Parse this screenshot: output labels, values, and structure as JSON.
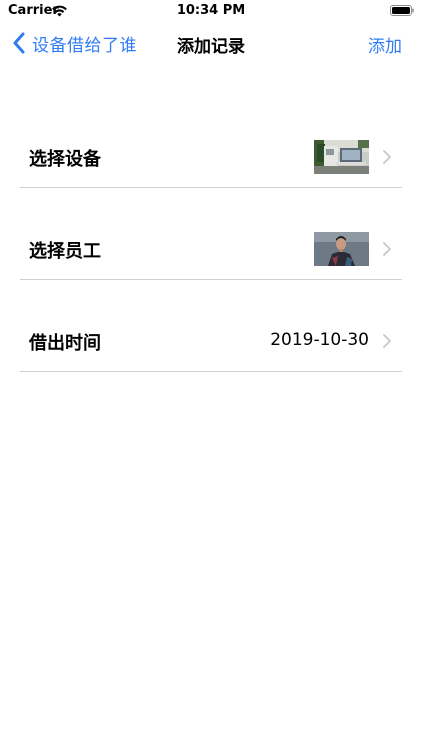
{
  "status_bar": {
    "carrier": "Carrier",
    "time": "10:34 PM",
    "wifi_icon": "wifi-icon",
    "battery_icon": "battery-icon"
  },
  "nav": {
    "back_label": "设备借给了谁",
    "title": "添加记录",
    "action_label": "添加",
    "back_icon": "chevron-left-icon",
    "accent_color": "#2F7CF6"
  },
  "rows": [
    {
      "label": "选择设备",
      "kind": "image",
      "image": "device-photo"
    },
    {
      "label": "选择员工",
      "kind": "image",
      "image": "employee-photo"
    },
    {
      "label": "借出时间",
      "kind": "text",
      "value": "2019-10-30"
    }
  ],
  "colors": {
    "separator": "#cfcfd2",
    "disclosure": "#c7c7cc"
  }
}
